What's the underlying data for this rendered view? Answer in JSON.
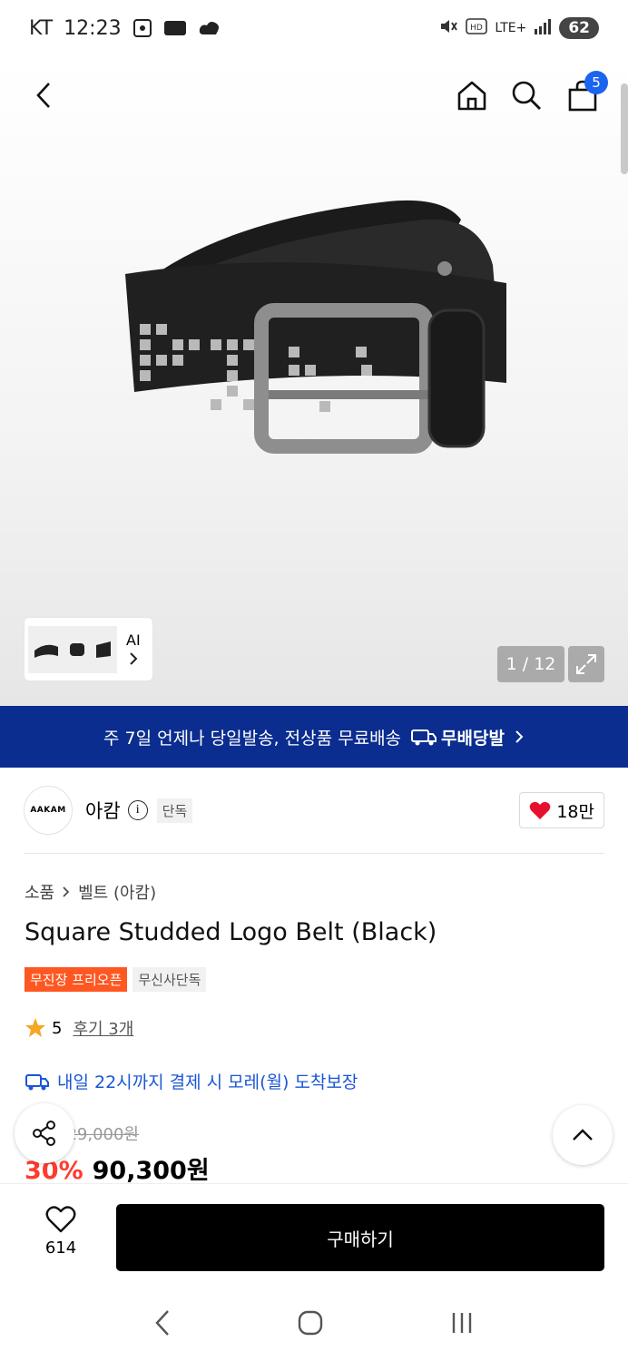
{
  "status_bar": {
    "carrier": "KT",
    "time": "12:23",
    "network": "LTE+",
    "battery": "62"
  },
  "header": {
    "cart_count": "5"
  },
  "gallery": {
    "ai_label": "AI",
    "counter": "1 / 12"
  },
  "banner": {
    "text": "주 7일 언제나 당일발송, 전상품 무료배송",
    "tag": "무배당발"
  },
  "brand": {
    "logo_text": "AAKAM",
    "name": "아캄",
    "exclusive_tag": "단독",
    "likes": "18만"
  },
  "product": {
    "breadcrumb": [
      "소품",
      "벨트 (아캄)"
    ],
    "title": "Square Studded Logo Belt (Black)",
    "tags": [
      "무진장 프리오픈",
      "무신사단독"
    ],
    "rating": "5",
    "review_link": "후기 3개",
    "delivery": "내일 22시까지 결제 시 모레(월) 도착보장",
    "original_price": "129,000원",
    "discount": "30%",
    "price": "90,300원"
  },
  "bottom": {
    "wish_count": "614",
    "buy_label": "구매하기"
  },
  "colors": {
    "banner_bg": "#0a2d8f",
    "badge_blue": "#1a64f0",
    "tag_red": "#ff5722",
    "discount_red": "#ff3b30",
    "link_blue": "#1a56d6"
  }
}
